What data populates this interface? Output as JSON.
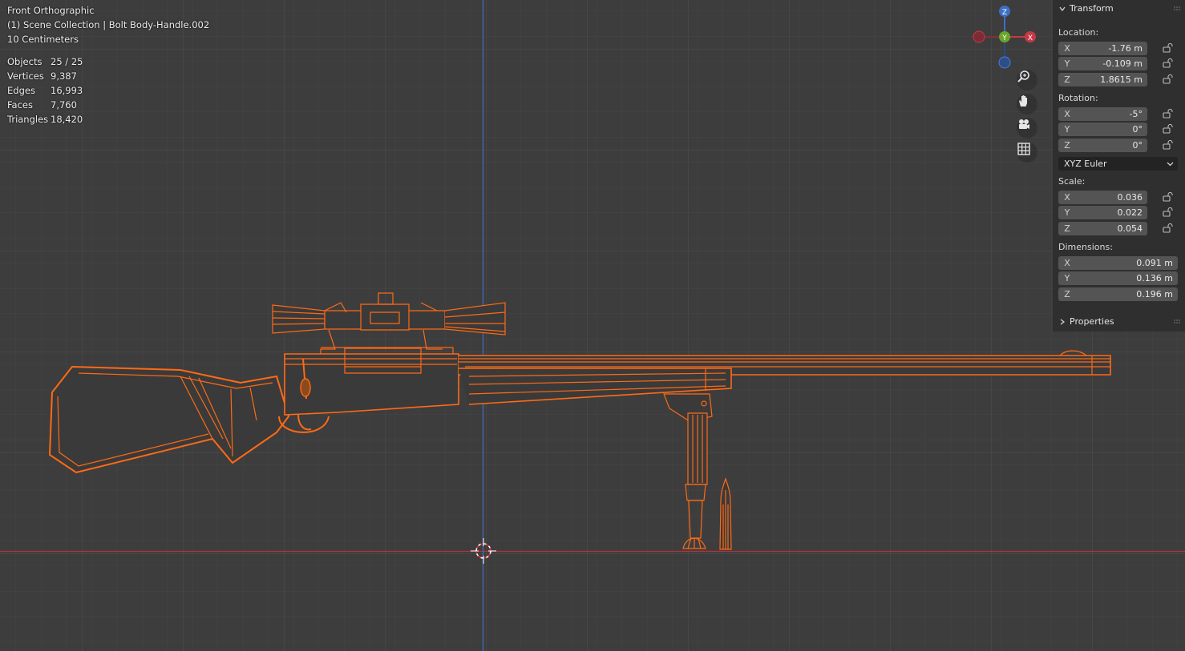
{
  "viewport": {
    "view_name": "Front Orthographic",
    "collection_line": "(1) Scene Collection | Bolt Body-Handle.002",
    "scale_label": "10 Centimeters",
    "stats": [
      {
        "key": "Objects",
        "value": "25 / 25"
      },
      {
        "key": "Vertices",
        "value": "9,387"
      },
      {
        "key": "Edges",
        "value": "16,993"
      },
      {
        "key": "Faces",
        "value": "7,760"
      },
      {
        "key": "Triangles",
        "value": "18,420"
      }
    ],
    "gizmo": {
      "z": "Z",
      "y": "Y",
      "x": "X"
    },
    "colors": {
      "background": "#3d3d3d",
      "grid": "#474747",
      "x_axis": "#b8323c",
      "z_axis": "#3f6fc4",
      "wire": "#ff6a16"
    }
  },
  "nav_icons": [
    "zoom-icon",
    "pan-hand-icon",
    "camera-icon",
    "grid-icon"
  ],
  "sidebar": {
    "transform_header": "Transform",
    "location_label": "Location:",
    "location": [
      {
        "axis": "X",
        "value": "-1.76 m"
      },
      {
        "axis": "Y",
        "value": "-0.109 m"
      },
      {
        "axis": "Z",
        "value": "1.8615 m"
      }
    ],
    "rotation_label": "Rotation:",
    "rotation": [
      {
        "axis": "X",
        "value": "-5°"
      },
      {
        "axis": "Y",
        "value": "0°"
      },
      {
        "axis": "Z",
        "value": "0°"
      }
    ],
    "rotation_mode": "XYZ Euler",
    "scale_label": "Scale:",
    "scale": [
      {
        "axis": "X",
        "value": "0.036"
      },
      {
        "axis": "Y",
        "value": "0.022"
      },
      {
        "axis": "Z",
        "value": "0.054"
      }
    ],
    "dimensions_label": "Dimensions:",
    "dimensions": [
      {
        "axis": "X",
        "value": "0.091 m"
      },
      {
        "axis": "Y",
        "value": "0.136 m"
      },
      {
        "axis": "Z",
        "value": "0.196 m"
      }
    ],
    "properties_header": "Properties"
  }
}
